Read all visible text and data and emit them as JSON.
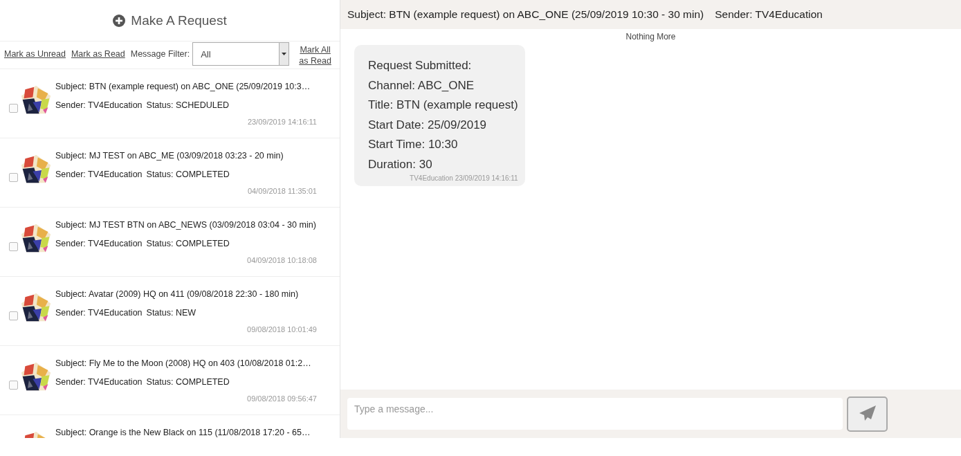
{
  "sidebar": {
    "new_request_button": "Make A Request",
    "toolbar": {
      "mark_unread": "Mark as Unread",
      "mark_read": "Mark as Read",
      "filter_label": "Message Filter:",
      "filter_value": "All",
      "mark_all_read": "Mark All as Read"
    },
    "messages": [
      {
        "subject": "Subject: BTN (example request) on ABC_ONE (25/09/2019 10:3…",
        "sender": "Sender: TV4Education",
        "status": "Status: SCHEDULED",
        "time": "23/09/2019 14:16:11",
        "checked": false
      },
      {
        "subject": "Subject: MJ TEST on ABC_ME (03/09/2018 03:23 - 20 min)",
        "sender": "Sender: TV4Education",
        "status": "Status: COMPLETED",
        "time": "04/09/2018 11:35:01",
        "checked": false
      },
      {
        "subject": "Subject: MJ TEST BTN on ABC_NEWS (03/09/2018 03:04 - 30 min)",
        "sender": "Sender: TV4Education",
        "status": "Status: COMPLETED",
        "time": "04/09/2018 10:18:08",
        "checked": false
      },
      {
        "subject": "Subject: Avatar (2009) HQ on 411 (09/08/2018 22:30 - 180 min)",
        "sender": "Sender: TV4Education",
        "status": "Status: NEW",
        "time": "09/08/2018 10:01:49",
        "checked": false
      },
      {
        "subject": "Subject: Fly Me to the Moon (2008) HQ on 403 (10/08/2018 01:2…",
        "sender": "Sender: TV4Education",
        "status": "Status: COMPLETED",
        "time": "09/08/2018 09:56:47",
        "checked": false
      },
      {
        "subject": "Subject: Orange is the New Black on 115 (11/08/2018 17:20 - 65…"
      }
    ]
  },
  "conversation": {
    "subject": "Subject: BTN (example request) on ABC_ONE (25/09/2019 10:30 - 30 min)",
    "sender": "Sender: TV4Education",
    "nothing_more": "Nothing More",
    "messages": [
      {
        "lines": [
          "Request Submitted:",
          "Channel: ABC_ONE",
          "Title: BTN (example request)",
          "Start Date: 25/09/2019",
          "Start Time: 10:30",
          "Duration: 30"
        ],
        "footer": "TV4Education 23/09/2019 14:16:11"
      }
    ],
    "composer": {
      "placeholder": "Type a message..."
    }
  }
}
